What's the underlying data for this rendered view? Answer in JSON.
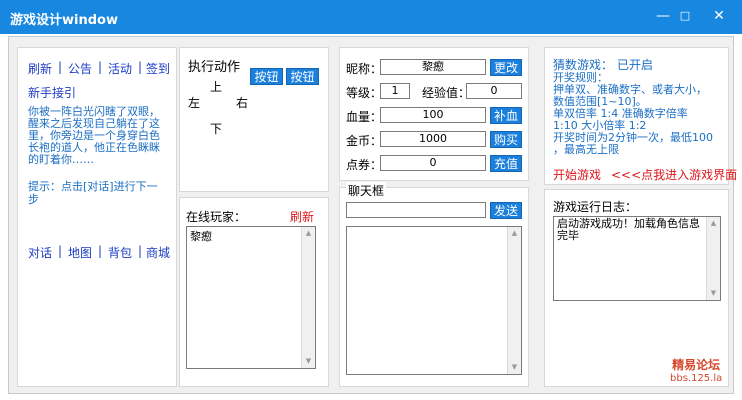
{
  "window": {
    "title": "游戏设计window",
    "min": "—",
    "max": "□",
    "close": "✕"
  },
  "left": {
    "nav": [
      "刷新",
      "公告",
      "活动",
      "签到"
    ],
    "guide_title": "新手接引",
    "story": [
      "你被一阵白光闪瞎了双眼，",
      "醒来之后发现自己躺在了这",
      "里，你旁边是一个身穿白色",
      "长袍的道人，他正在色眯眯",
      "的盯着你……"
    ],
    "hint": [
      "提示：点击[对话]进行下一",
      "步"
    ],
    "bottom_nav": [
      "对话",
      "地图",
      "背包",
      "商城"
    ],
    "sep": "|"
  },
  "action": {
    "title": "执行动作",
    "up": "上",
    "left": "左",
    "right": "右",
    "down": "下",
    "btn1": "按钮",
    "btn2": "按钮"
  },
  "online": {
    "title": "在线玩家：",
    "refresh": "刷新",
    "players": [
      "黎瘛"
    ]
  },
  "stats": {
    "nickname_label": "昵称：",
    "nickname": "黎瘛",
    "change_btn": "更改",
    "level_label": "等级：",
    "level": "1",
    "exp_label": "经验值：",
    "exp": "0",
    "hp_label": "血量：",
    "hp": "100",
    "heal_btn": "补血",
    "gold_label": "金币：",
    "gold": "1000",
    "buy_btn": "购买",
    "points_label": "点券：",
    "points": "0",
    "recharge_btn": "充值"
  },
  "chat": {
    "title": "聊天框",
    "send_btn": "发送",
    "input": ""
  },
  "game": {
    "status_label": "猜数游戏：",
    "status": "已开启",
    "rules": [
      "开奖规则：",
      "押单双、准确数字、或者大小，",
      "数值范围[1~10]。",
      "单双倍率 1:4 准确数字倍率",
      "1:10 大小倍率 1:2",
      "开奖时间为2分钟一次，最低100",
      "，最高无上限"
    ],
    "start_label": "开始游戏",
    "enter_label": "<<<点我进入游戏界面"
  },
  "log": {
    "title": "游戏运行日志：",
    "lines": [
      "启动游戏成功！加载角色信息",
      "完毕"
    ]
  },
  "watermark": {
    "line1": "精易论坛",
    "line2": "bbs.125.la"
  },
  "colors": {
    "titlebar": "#1787e0",
    "button": "#1b7fdc",
    "link": "#1c3cc4",
    "text_blue": "#1c6fc4",
    "red": "#e0151b"
  }
}
